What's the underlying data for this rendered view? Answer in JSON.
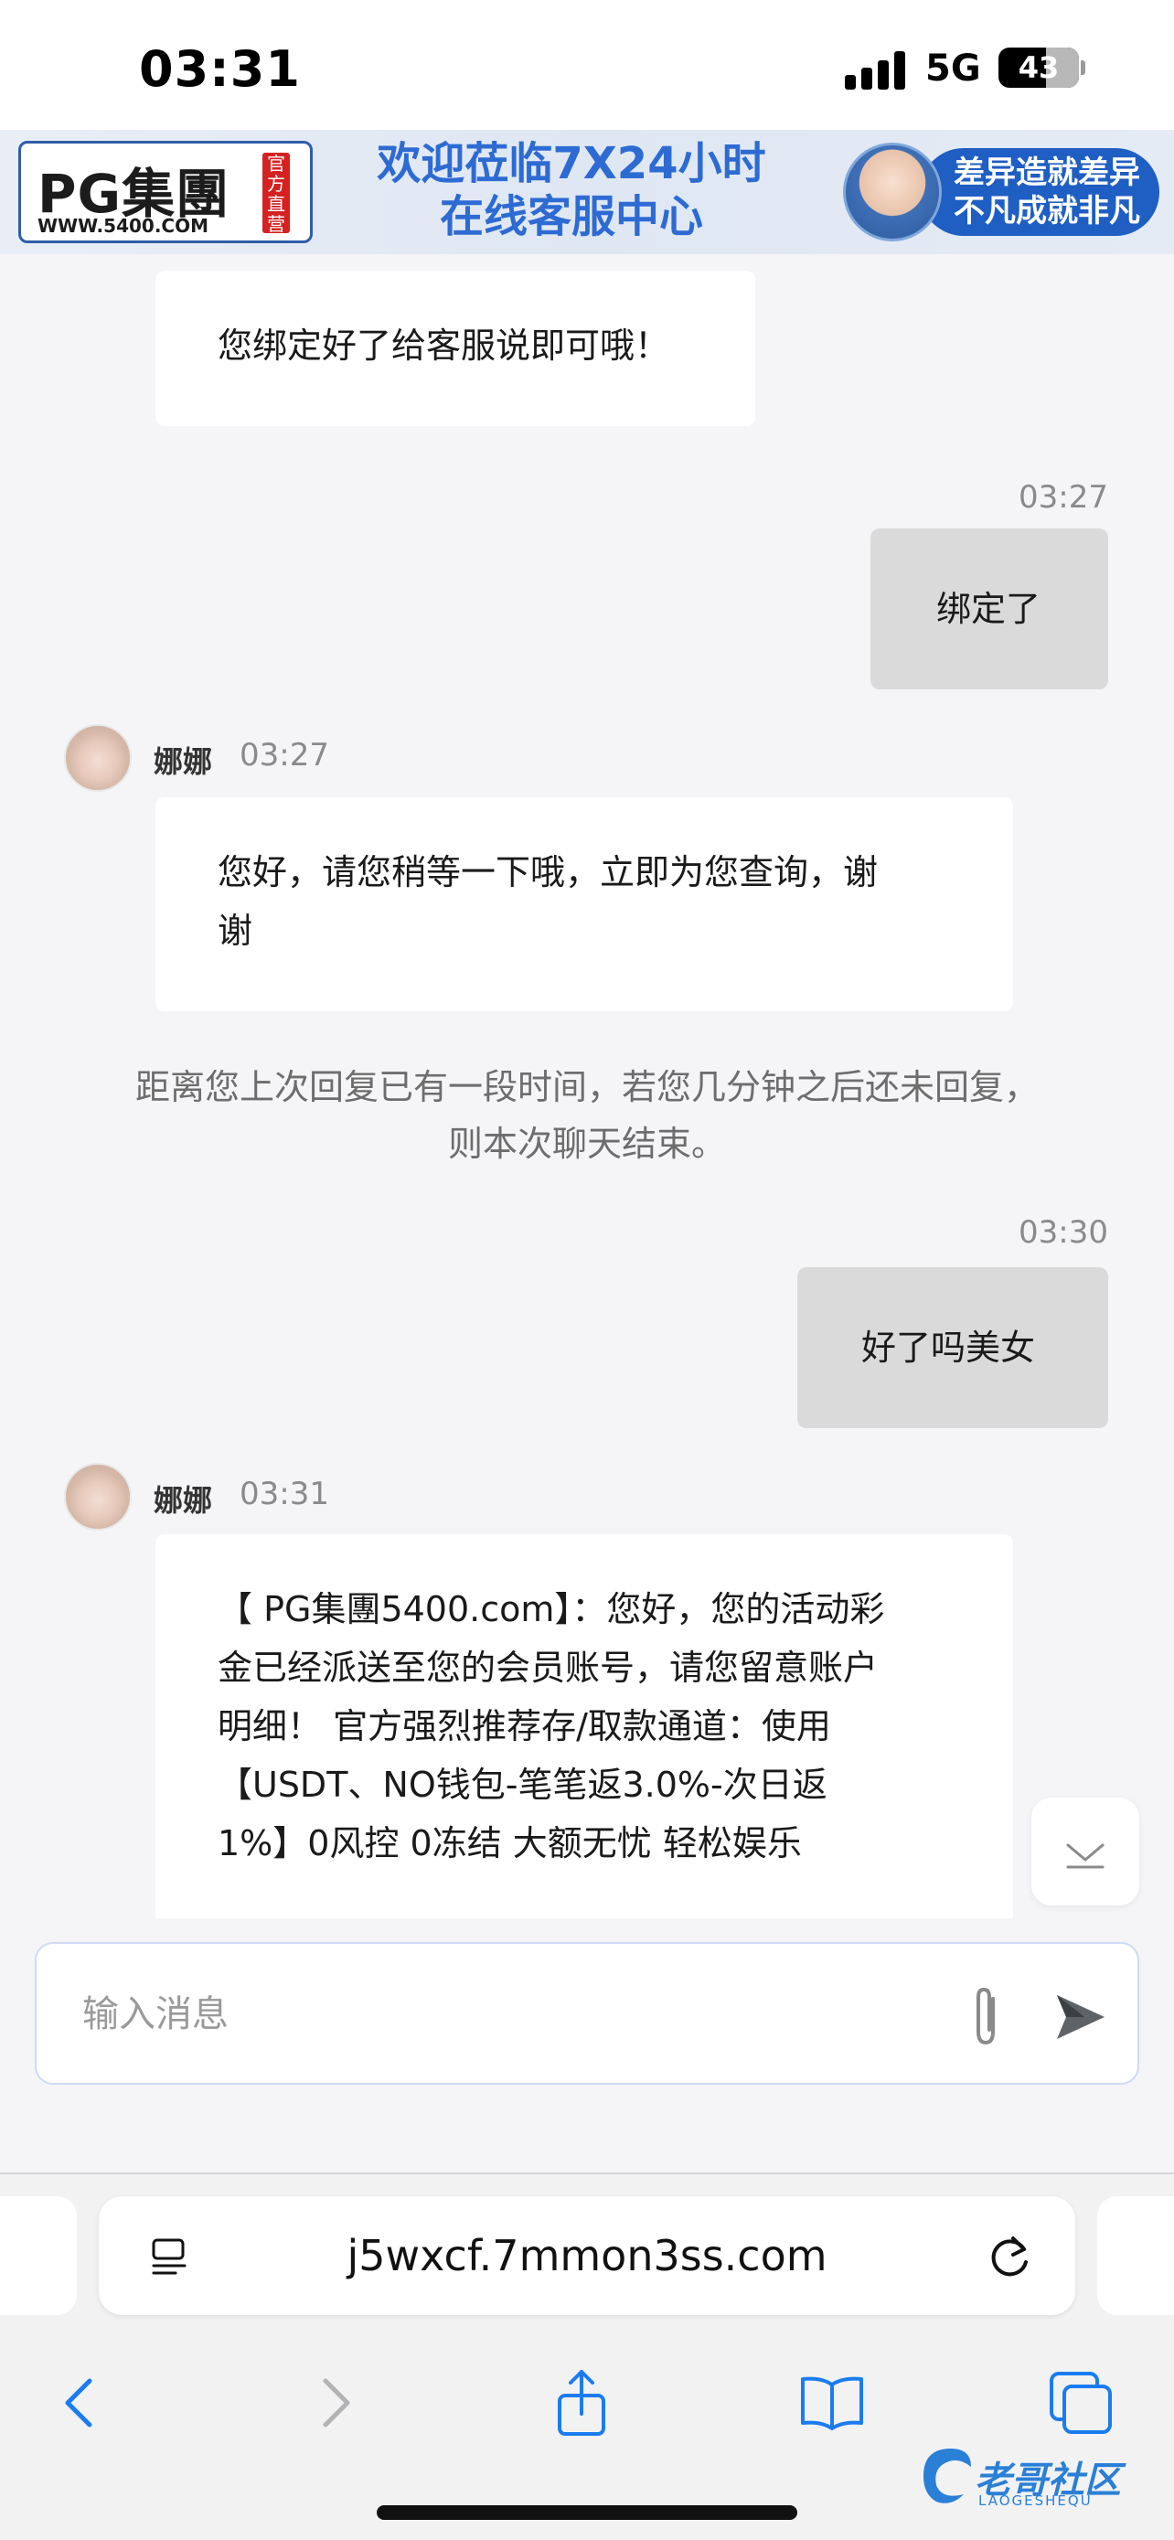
{
  "status_bar": {
    "time": "03:31",
    "network": "5G",
    "battery": "43"
  },
  "banner": {
    "logo_text": "PG集團",
    "logo_url": "WWW.5400.COM",
    "logo_stamp": "官方直营",
    "title_line1": "欢迎莅临7X24小时",
    "title_line2": "在线客服中心",
    "slogan_line1": "差异造就差异",
    "slogan_line2": "不凡成就非凡"
  },
  "chat": {
    "messages": [
      {
        "from": "agent",
        "text": "您绑定好了给客服说即可哦！"
      },
      {
        "from": "user",
        "time": "03:27",
        "text": "绑定了"
      },
      {
        "from": "agent",
        "name": "娜娜",
        "time": "03:27",
        "text_line1": "您好，请您稍等一下哦，立即为您查询，谢",
        "text_line2": "谢"
      },
      {
        "from": "system",
        "line1": "距离您上次回复已有一段时间，若您几分钟之后还未回复，",
        "line2": "则本次聊天结束。"
      },
      {
        "from": "user",
        "time": "03:30",
        "text": "好了吗美女"
      },
      {
        "from": "agent",
        "name": "娜娜",
        "time": "03:31",
        "lines": [
          "【 PG集團5400.com】：您好，您的活动彩",
          "金已经派送至您的会员账号，请您留意账户",
          "明细！ 官方强烈推荐存/取款通道：使用",
          "【USDT、NO钱包-笔笔返3.0%-次日返",
          "1%】0风控 0冻结 大额无忧 轻松娱乐"
        ]
      }
    ]
  },
  "composer": {
    "placeholder": "输入消息"
  },
  "browser": {
    "url": "j5wxcf.7mmon3ss.com"
  },
  "watermark": {
    "text": "老哥社区",
    "sub": "LAOGESHEQU"
  },
  "colors": {
    "accent": "#2d6bd3",
    "user_bubble": "#dadada",
    "agent_bubble": "#ffffff",
    "ios_blue": "#1a7cf0"
  },
  "icons": [
    "page-menu-icon",
    "reload-icon",
    "back-icon",
    "forward-icon",
    "share-icon",
    "bookmarks-icon",
    "tabs-icon",
    "attach-icon",
    "send-icon",
    "chevron-down-icon"
  ]
}
